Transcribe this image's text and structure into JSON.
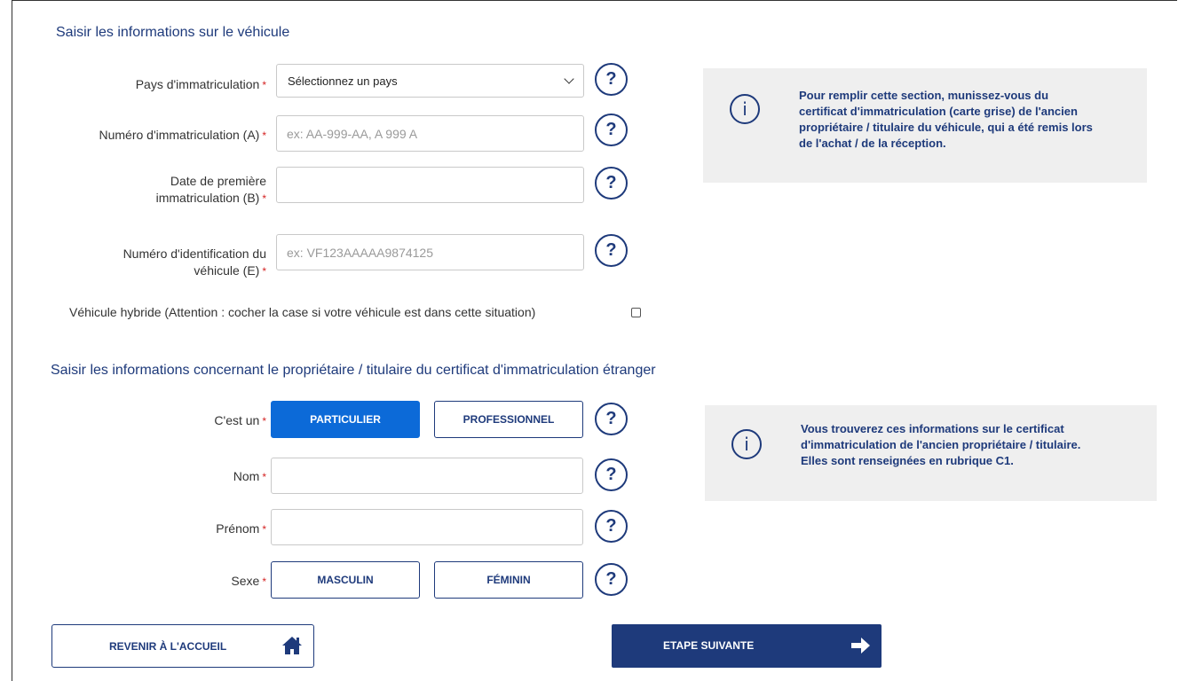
{
  "vehicle_section": {
    "title": "Saisir les informations sur le véhicule",
    "country": {
      "label": "Pays d'immatriculation",
      "value": "Sélectionnez un pays"
    },
    "plate": {
      "label": "Numéro d'immatriculation (A)",
      "placeholder": "ex: AA-999-AA, A 999 A"
    },
    "first_reg": {
      "label_line1": "Date de première",
      "label_line2": "immatriculation (B)"
    },
    "vin": {
      "label_line1": "Numéro d'identification du",
      "label_line2": "véhicule (E)",
      "placeholder": "ex: VF123AAAAA9874125"
    },
    "hybrid_label": "Véhicule hybride (Attention : cocher la case si votre véhicule est dans cette situation)",
    "hybrid_checked": false,
    "info_lines": [
      "Pour remplir cette section, munissez-vous du",
      "certificat d'immatriculation (carte grise) de l'ancien",
      "propriétaire / titulaire du véhicule, qui a été remis lors",
      "de l'achat / de la réception."
    ]
  },
  "owner_section": {
    "title": "Saisir les informations concernant le propriétaire / titulaire du certificat d'immatriculation étranger",
    "type_label": "C'est un",
    "type_options": [
      "PARTICULIER",
      "PROFESSIONNEL"
    ],
    "type_selected": "PARTICULIER",
    "nom_label": "Nom",
    "prenom_label": "Prénom",
    "sexe_label": "Sexe",
    "sexe_options": [
      "MASCULIN",
      "FÉMININ"
    ],
    "info_lines": [
      "Vous trouverez ces informations sur le certificat",
      "d'immatriculation de l'ancien propriétaire / titulaire.",
      "Elles sont renseignées en rubrique C1."
    ]
  },
  "required_mark": "*",
  "help_glyph": "?",
  "info_glyph": "i",
  "actions": {
    "home_label": "REVENIR À L'ACCUEIL",
    "home_icon": "home-icon",
    "next_label": "ETAPE SUIVANTE",
    "next_icon": "arrow-right-icon"
  },
  "colors": {
    "primary": "#1e3a7b",
    "active_button": "#0c6ad8",
    "required": "#d42323",
    "info_background": "#efefef"
  }
}
